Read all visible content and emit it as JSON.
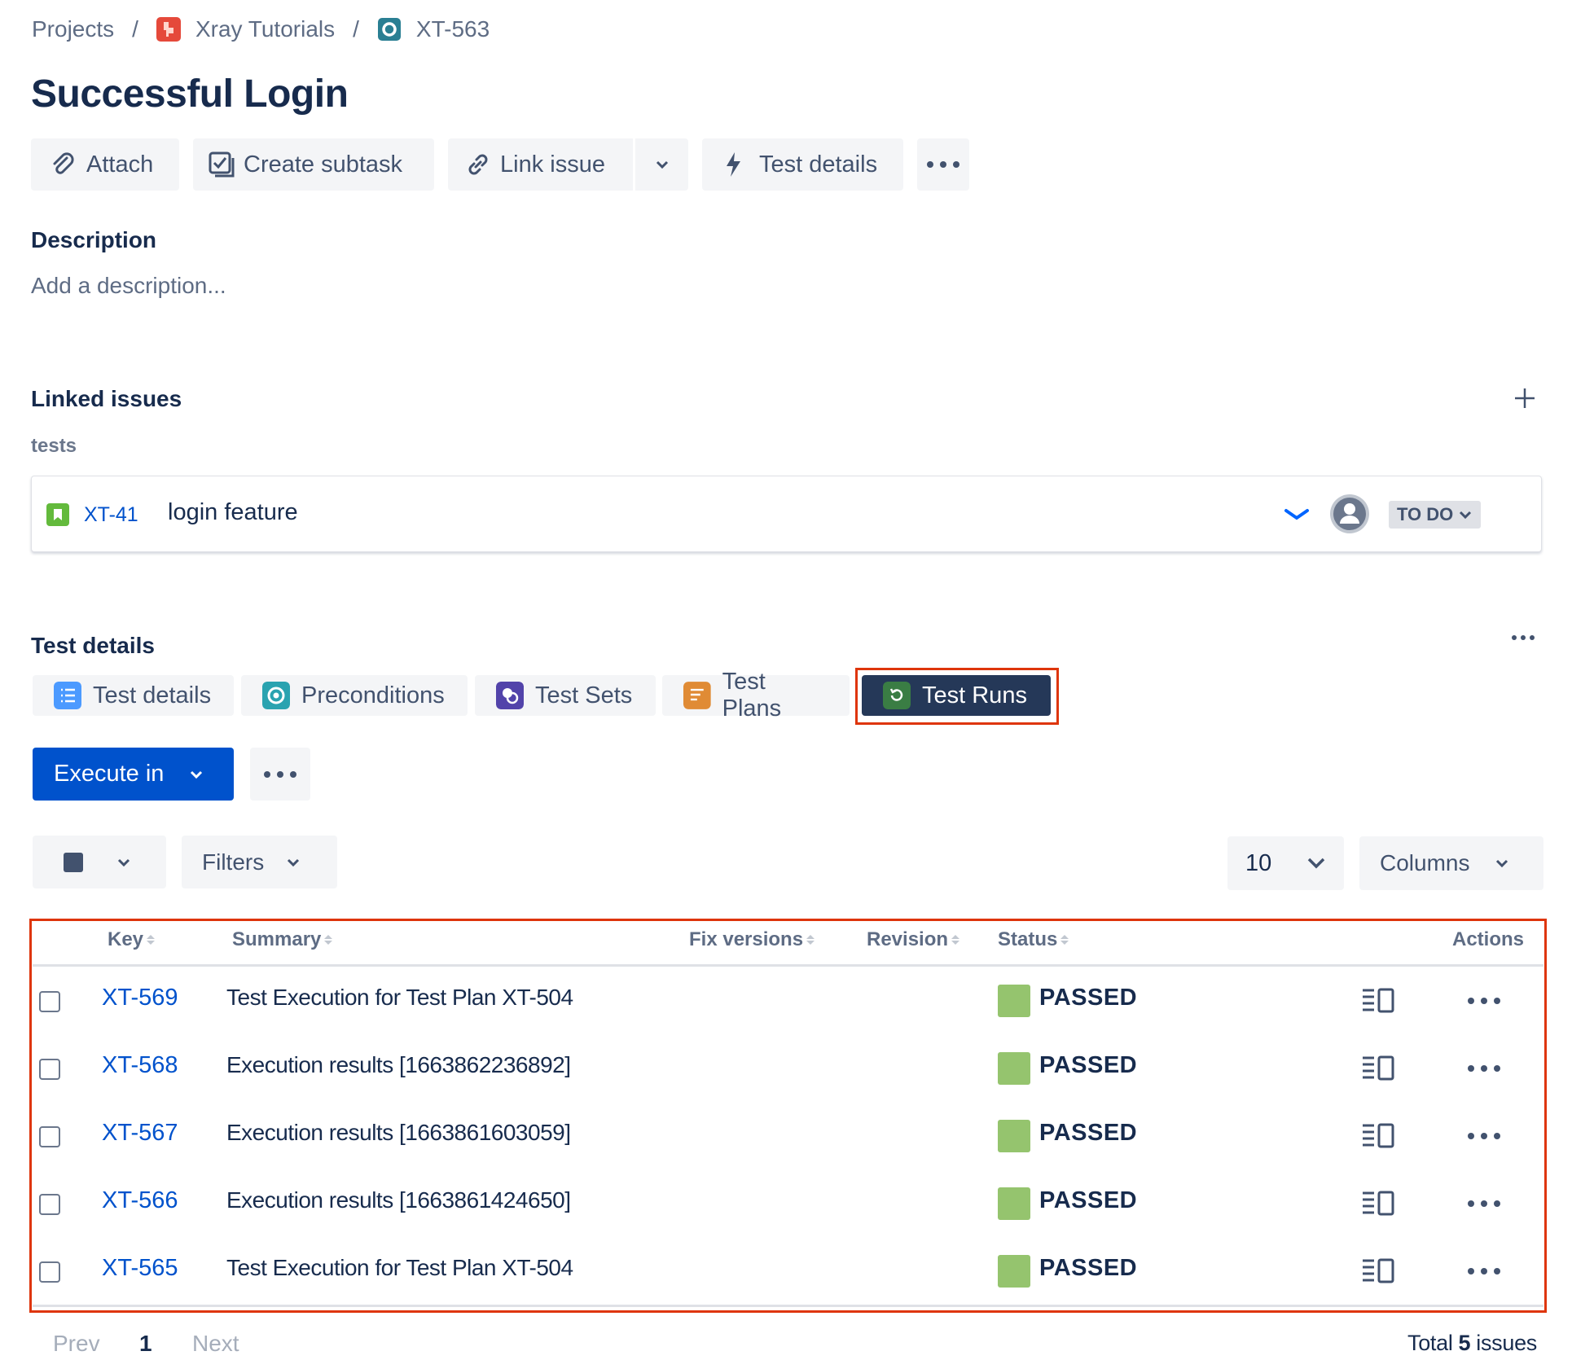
{
  "breadcrumb": {
    "projects": "Projects",
    "project": "Xray Tutorials",
    "issue_key": "XT-563",
    "separator": "/"
  },
  "issue": {
    "title": "Successful Login"
  },
  "toolbar": {
    "attach": "Attach",
    "create_subtask": "Create subtask",
    "link_issue": "Link issue",
    "test_details": "Test details"
  },
  "description": {
    "title": "Description",
    "placeholder": "Add a description..."
  },
  "linked_issues": {
    "title": "Linked issues",
    "relation": "tests",
    "item": {
      "key": "XT-41",
      "summary": "login feature",
      "status": "TO DO"
    }
  },
  "test_details": {
    "title": "Test details",
    "tabs": [
      {
        "label": "Test details",
        "icon": "list-icon",
        "color": "#4c9aff"
      },
      {
        "label": "Preconditions",
        "icon": "precondition-icon",
        "color": "#2aa3b0"
      },
      {
        "label": "Test Sets",
        "icon": "test-set-icon",
        "color": "#5243aa"
      },
      {
        "label": "Test Plans",
        "icon": "test-plan-icon",
        "color": "#e08b35"
      },
      {
        "label": "Test Runs",
        "icon": "test-run-icon",
        "color": "#3a7d44",
        "active": true
      }
    ],
    "execute_label": "Execute in",
    "filters_label": "Filters",
    "page_size": "10",
    "columns_label": "Columns"
  },
  "table": {
    "headers": {
      "key": "Key",
      "summary": "Summary",
      "fix_versions": "Fix versions",
      "revision": "Revision",
      "status": "Status",
      "actions": "Actions"
    },
    "rows": [
      {
        "key": "XT-569",
        "summary": "Test Execution for Test Plan XT-504",
        "status": "PASSED"
      },
      {
        "key": "XT-568",
        "summary": "Execution results [1663862236892]",
        "status": "PASSED"
      },
      {
        "key": "XT-567",
        "summary": "Execution results [1663861603059]",
        "status": "PASSED"
      },
      {
        "key": "XT-566",
        "summary": "Execution results [1663861424650]",
        "status": "PASSED"
      },
      {
        "key": "XT-565",
        "summary": "Test Execution for Test Plan XT-504",
        "status": "PASSED"
      }
    ]
  },
  "pagination": {
    "prev": "Prev",
    "current": "1",
    "next": "Next",
    "total_prefix": "Total",
    "total_count": "5",
    "total_suffix": "issues"
  },
  "colors": {
    "primary": "#0052cc",
    "active_tab": "#253858",
    "passed": "#95c46e",
    "highlight": "#de350b"
  }
}
